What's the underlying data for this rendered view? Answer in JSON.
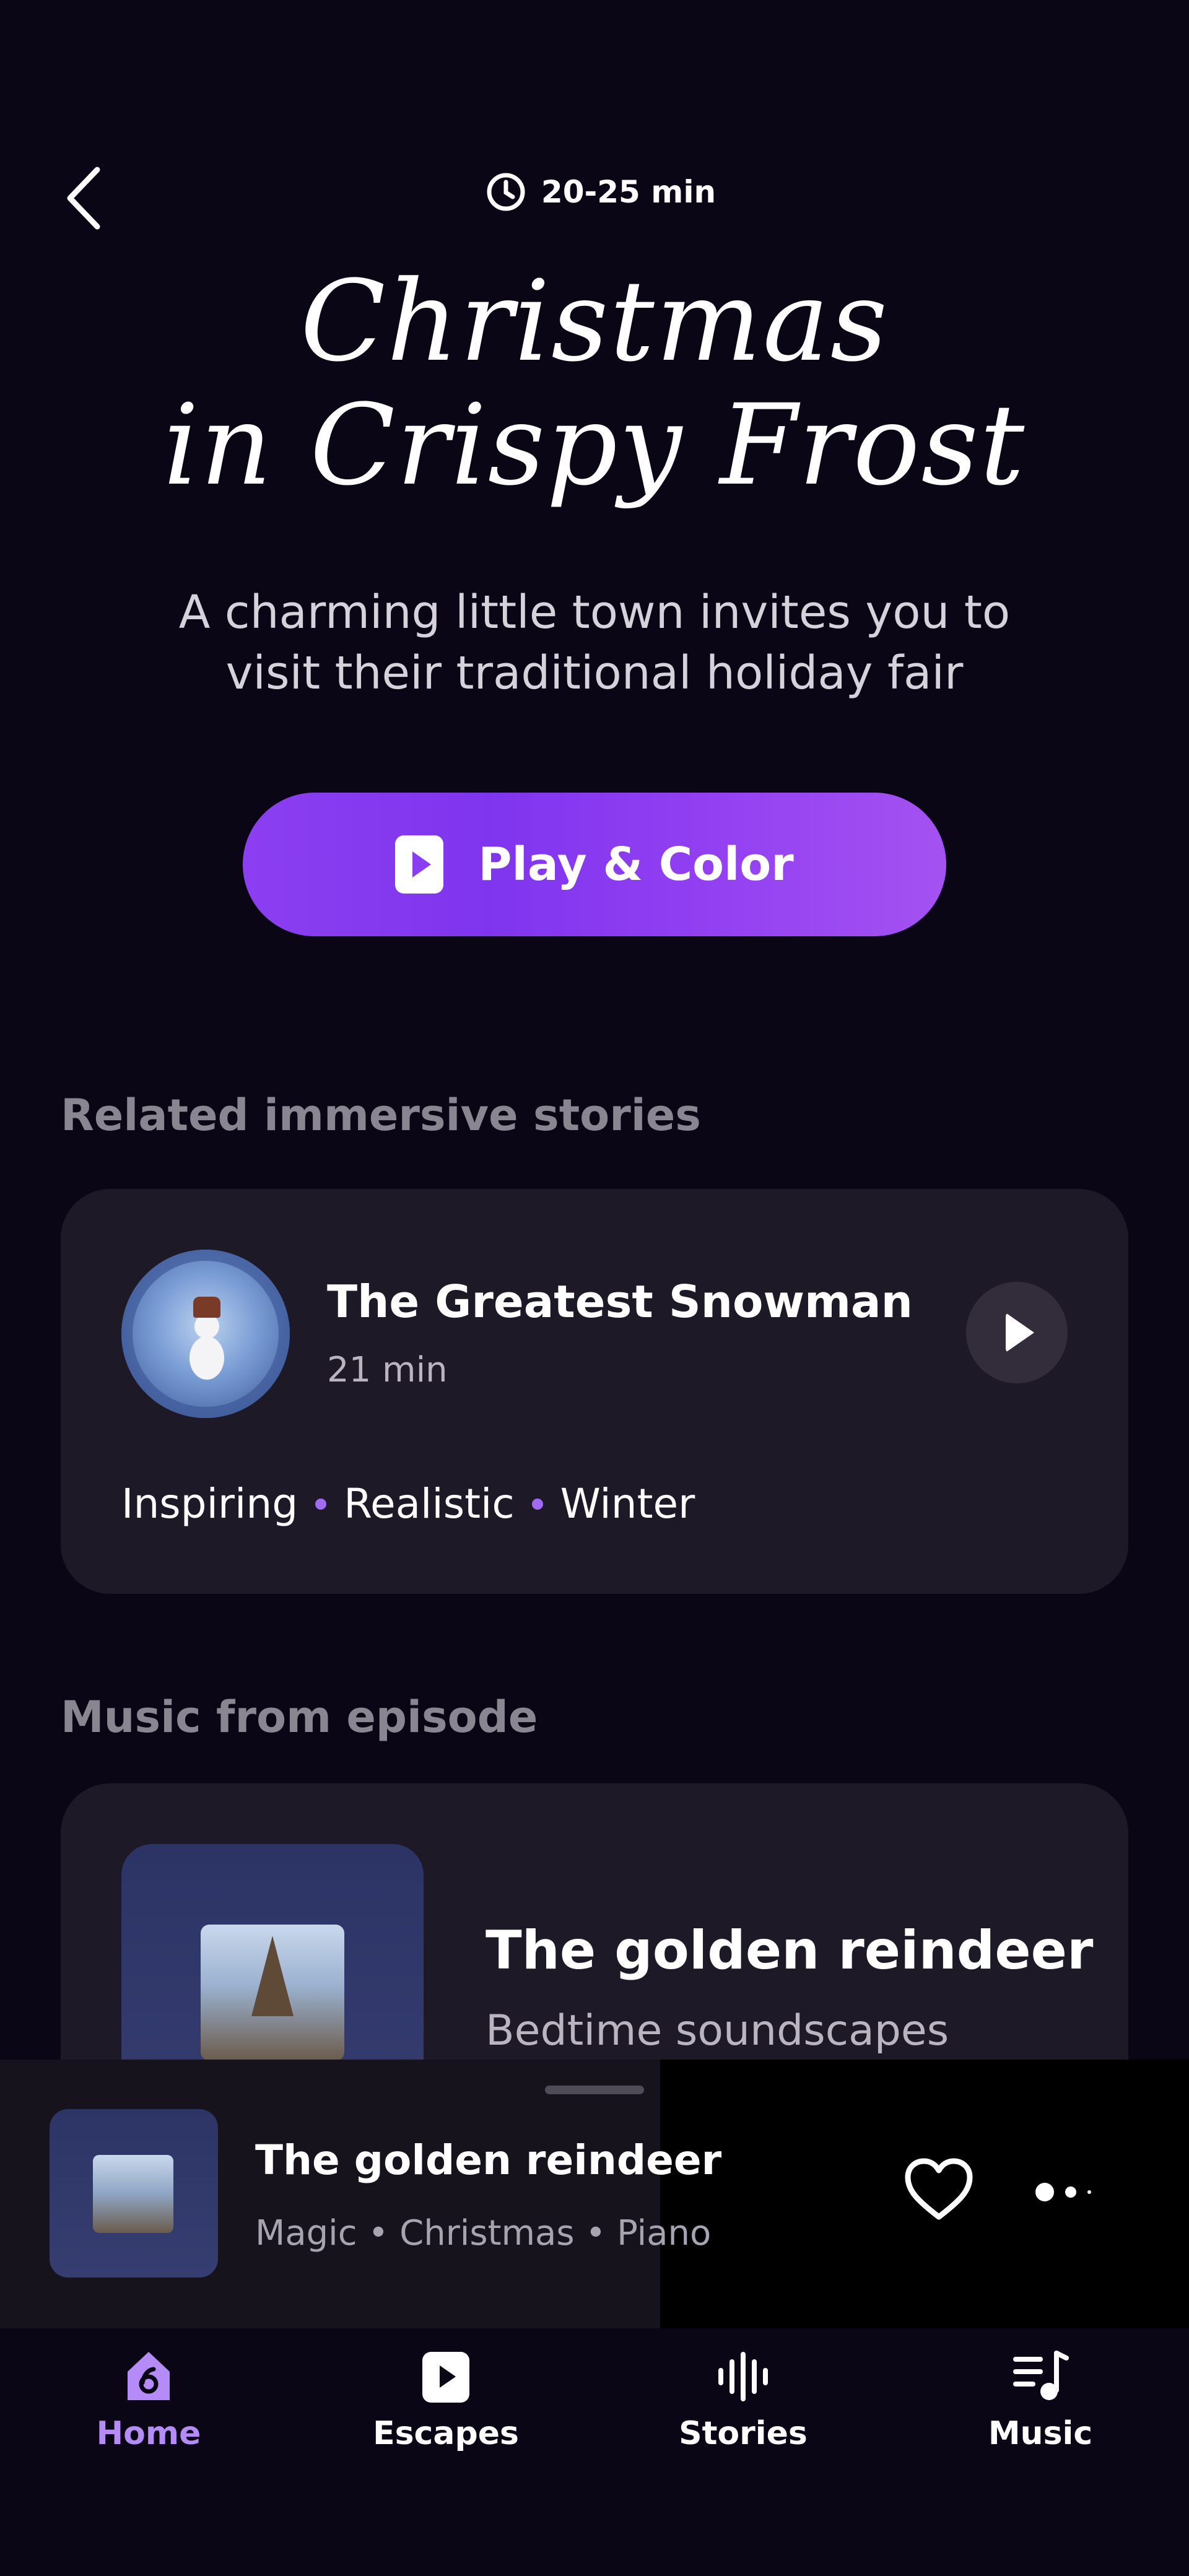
{
  "header": {
    "duration": "20-25 min",
    "title_line1": "Christmas",
    "title_line2": "in Crispy Frost",
    "subtitle_line1": "A charming little town invites you to",
    "subtitle_line2": "visit their traditional holiday fair",
    "play_label": "Play & Color"
  },
  "related": {
    "section_title": "Related immersive stories",
    "story": {
      "title": "The Greatest Snowman",
      "duration": "21 min",
      "tags": [
        "Inspiring",
        "Realistic",
        "Winter"
      ]
    }
  },
  "music": {
    "section_title": "Music from episode",
    "track": {
      "title": "The golden reindeer",
      "subtitle": "Bedtime soundscapes"
    }
  },
  "mini_player": {
    "title": "The golden reindeer",
    "meta": "Magic • Christmas • Piano"
  },
  "nav": {
    "items": [
      {
        "label": "Home",
        "icon": "home-icon",
        "active": true
      },
      {
        "label": "Escapes",
        "icon": "play-square-icon",
        "active": false
      },
      {
        "label": "Stories",
        "icon": "waveform-icon",
        "active": false
      },
      {
        "label": "Music",
        "icon": "music-list-icon",
        "active": false
      }
    ]
  },
  "colors": {
    "background": "#0b0615",
    "accent": "#8c3ff1",
    "card": "#1e1927",
    "nav_active": "#b58cf7"
  }
}
